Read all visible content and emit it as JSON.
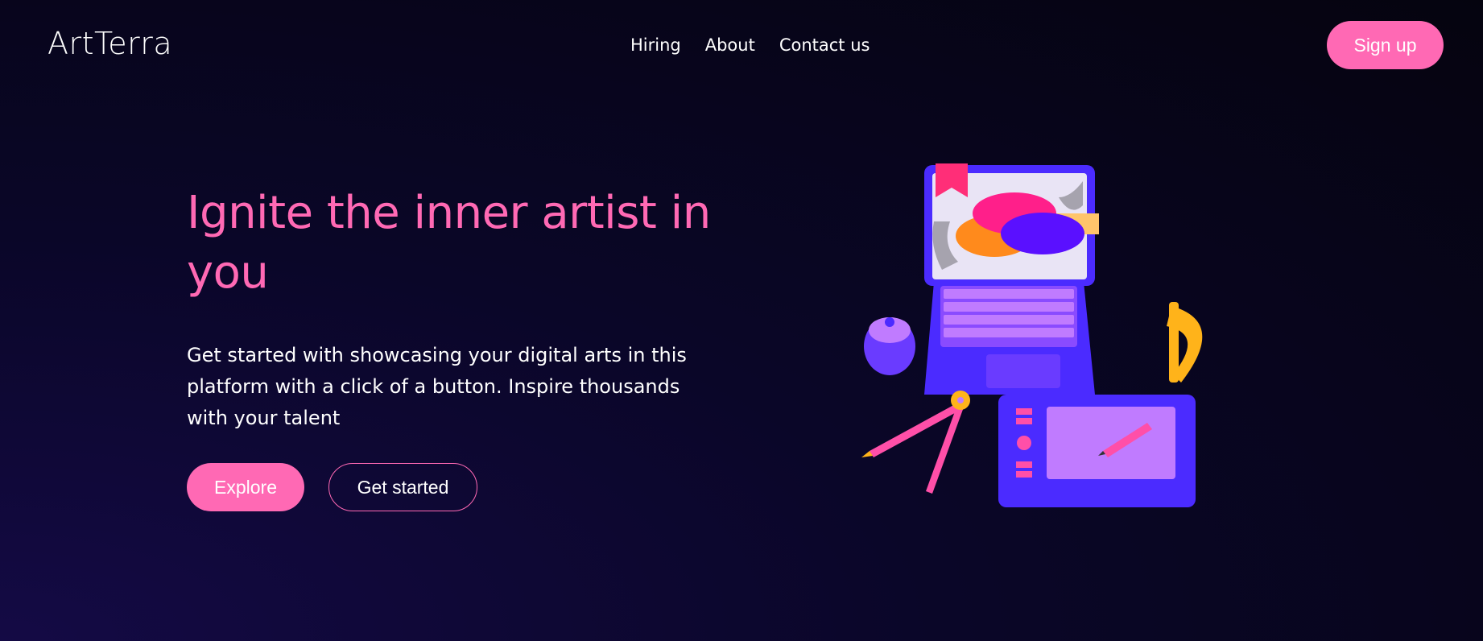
{
  "brand": {
    "name": "ArtTerra"
  },
  "nav": {
    "items": [
      {
        "label": "Hiring"
      },
      {
        "label": "About"
      },
      {
        "label": "Contact us"
      }
    ]
  },
  "header": {
    "signup_label": "Sign up"
  },
  "hero": {
    "title": "Ignite the inner artist in you",
    "description": "Get started with showcasing your digital arts in this platform with a click of a button. Inspire thousands with your talent",
    "explore_label": "Explore",
    "get_started_label": "Get started"
  },
  "illustration": {
    "icon": "art-workstation-illustration"
  },
  "colors": {
    "accent": "#ff69b4",
    "background": "#0a0628",
    "purple": "#5a2bff",
    "lavender": "#b56cff"
  }
}
